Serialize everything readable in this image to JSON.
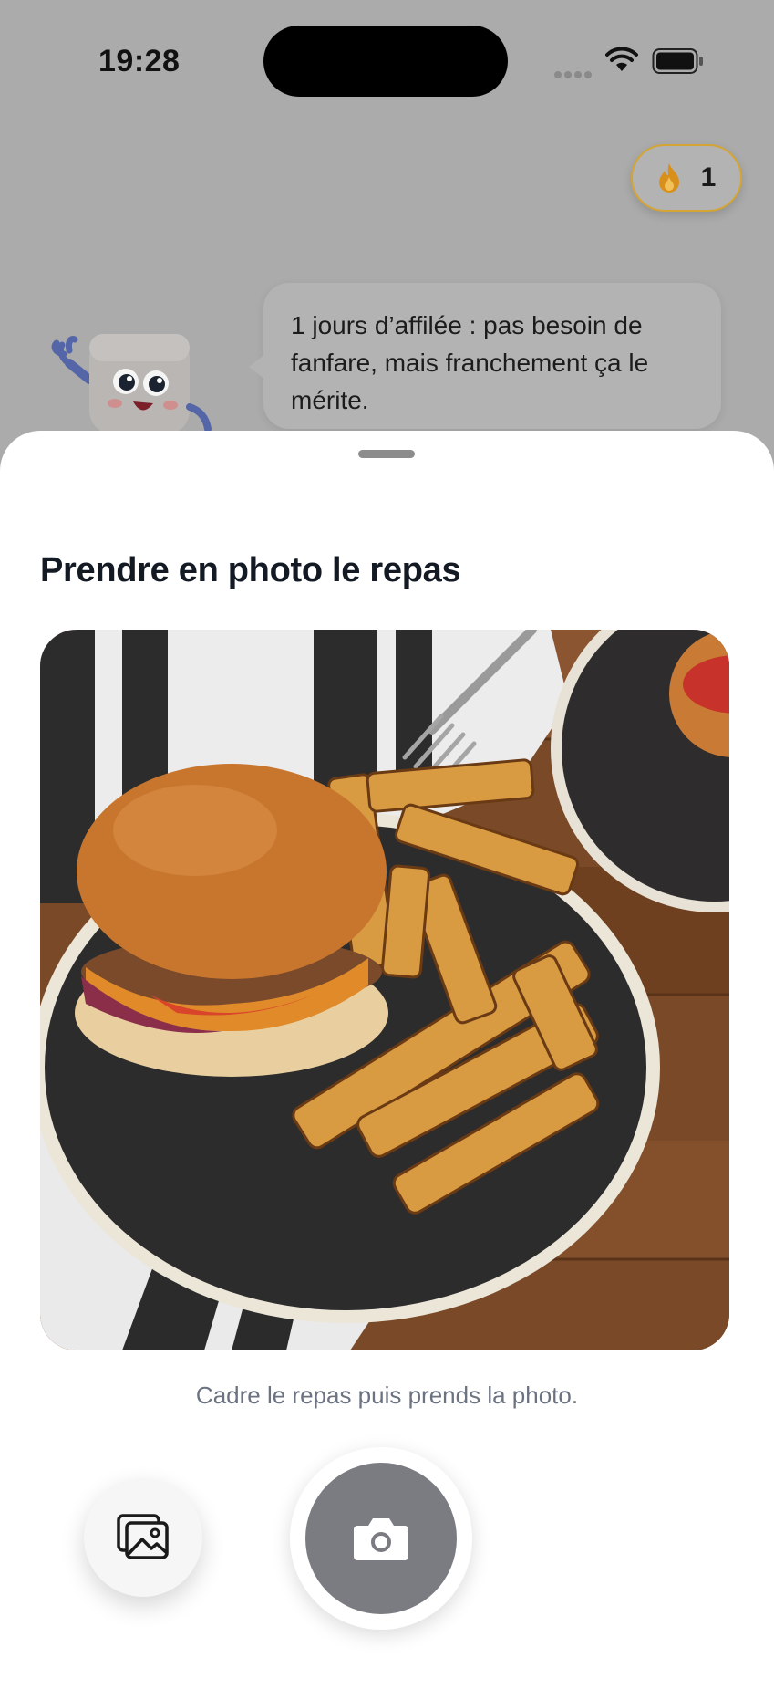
{
  "status_bar": {
    "time": "19:28"
  },
  "streak": {
    "count": "1",
    "icon": "flame-icon",
    "accent_color": "#d4a534",
    "flame_color": "#d9901b"
  },
  "mascot": {
    "icon": "marshmallow-mascot"
  },
  "bubble": {
    "text": "1 jours d’affilée : pas besoin de fanfare, mais franchement ça le mérite."
  },
  "sheet": {
    "title": "Prendre en photo le repas",
    "hint": "Cadre le repas puis prends la photo.",
    "gallery_icon": "photo-gallery-icon",
    "shutter_icon": "camera-icon",
    "shutter_color": "#7a7c82"
  }
}
